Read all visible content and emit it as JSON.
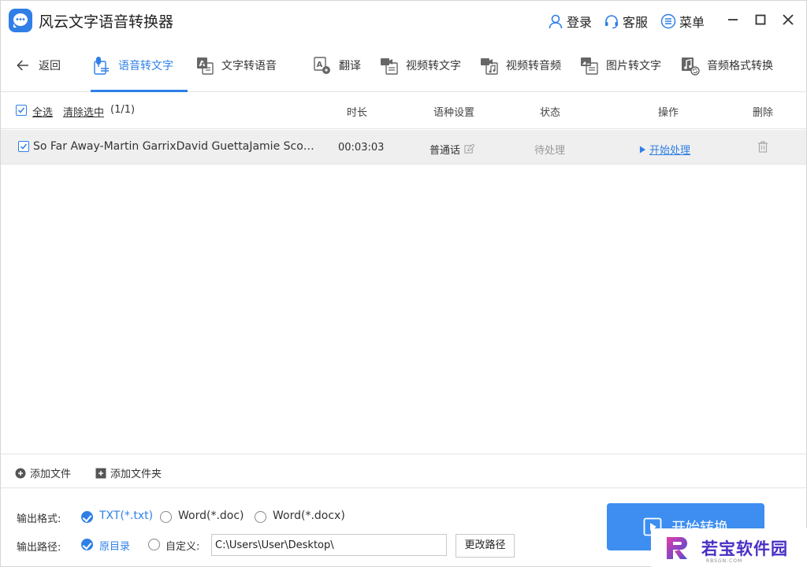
{
  "app": {
    "title": "风云文字语音转换器"
  },
  "titlebar": {
    "login": "登录",
    "service": "客服",
    "menu": "菜单"
  },
  "nav": {
    "back": "返回",
    "tabs": [
      {
        "label": "语音转文字",
        "active": true
      },
      {
        "label": "文字转语音"
      },
      {
        "label": "翻译"
      },
      {
        "label": "视频转文字"
      },
      {
        "label": "视频转音频"
      },
      {
        "label": "图片转文字"
      },
      {
        "label": "音频格式转换"
      }
    ]
  },
  "list": {
    "select_all": "全选",
    "clear_selection": "清除选中",
    "count": "(1/1)",
    "columns": {
      "duration": "时长",
      "language": "语种设置",
      "status": "状态",
      "action": "操作",
      "delete": "删除"
    },
    "rows": [
      {
        "checked": true,
        "filename": "So Far Away-Martin GarrixDavid GuettaJamie ScottRomy Dya",
        "duration": "00:03:03",
        "language": "普通话",
        "status": "待处理",
        "action": "开始处理"
      }
    ]
  },
  "add": {
    "file": "添加文件",
    "folder": "添加文件夹"
  },
  "output": {
    "format_label": "输出格式:",
    "formats": [
      {
        "label": "TXT(*.txt)",
        "selected": true
      },
      {
        "label": "Word(*.doc)",
        "selected": false
      },
      {
        "label": "Word(*.docx)",
        "selected": false
      }
    ],
    "path_label": "输出路径:",
    "path_options": [
      {
        "label": "原目录",
        "selected": true
      },
      {
        "label": "自定义:",
        "selected": false
      }
    ],
    "path_value": "C:\\Users\\User\\Desktop\\",
    "change_path": "更改路径",
    "convert": "开始转换"
  },
  "watermark": {
    "text": "若宝软件园",
    "sub": "RBSGN.COM"
  },
  "colors": {
    "accent": "#2f7fe6",
    "button": "#3d8ef0",
    "row_bg": "#efefef"
  }
}
